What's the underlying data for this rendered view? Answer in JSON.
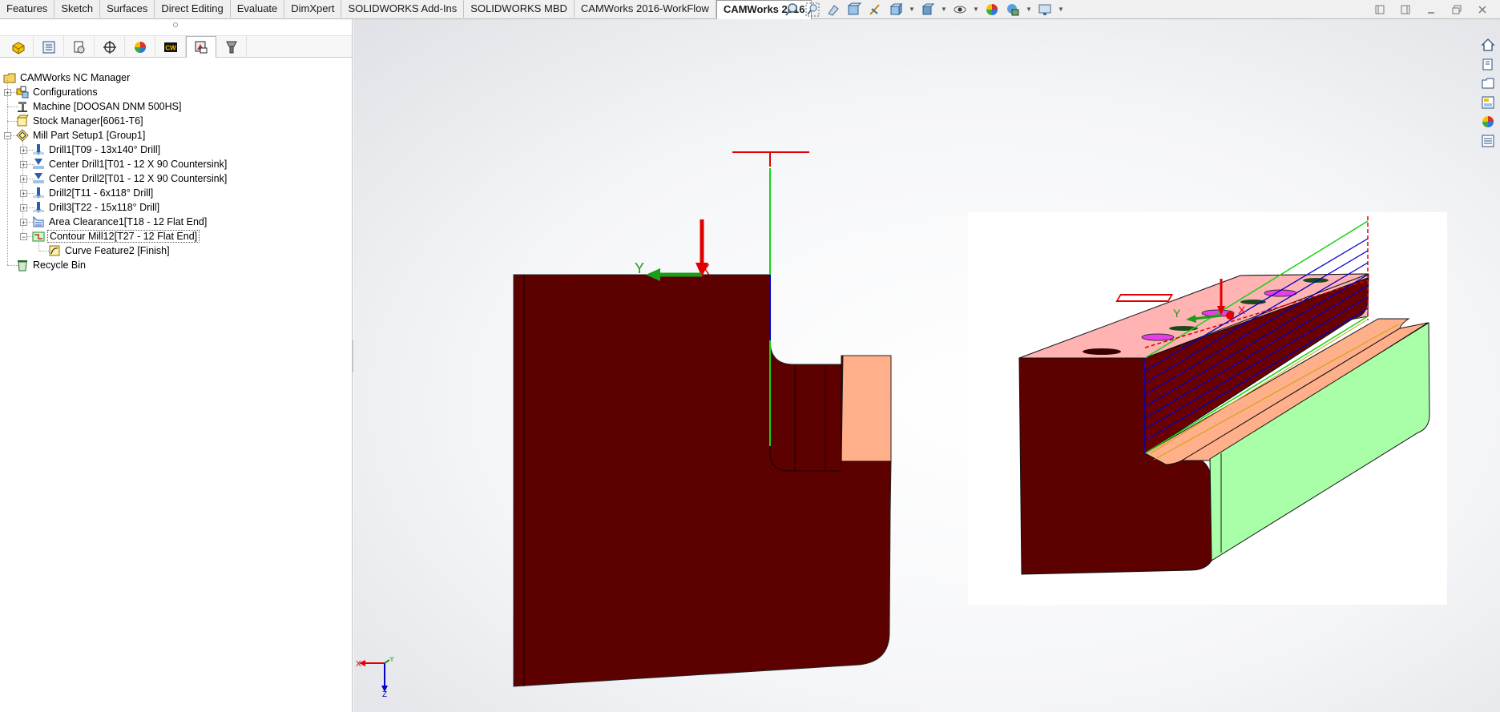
{
  "tabs": [
    {
      "label": "Features"
    },
    {
      "label": "Sketch"
    },
    {
      "label": "Surfaces"
    },
    {
      "label": "Direct Editing"
    },
    {
      "label": "Evaluate"
    },
    {
      "label": "DimXpert"
    },
    {
      "label": "SOLIDWORKS Add-Ins"
    },
    {
      "label": "SOLIDWORKS MBD"
    },
    {
      "label": "CAMWorks 2016-WorkFlow"
    },
    {
      "label": "CAMWorks 2016",
      "active": true
    }
  ],
  "view_toolbar": {
    "icons": [
      "zoom-to-fit-icon",
      "zoom-to-area-icon",
      "previous-view-icon",
      "section-view-icon",
      "dynamic-annotation-icon",
      "view-orientation-icon",
      "display-style-icon",
      "hide-show-items-icon",
      "edit-appearance-icon",
      "apply-scene-icon",
      "view-settings-icon"
    ]
  },
  "window_controls": [
    "restore-icon",
    "tile-icon",
    "minimize-icon",
    "maximize-icon",
    "close-icon"
  ],
  "manager_tabs": [
    {
      "name": "camworks-feature-tree-icon"
    },
    {
      "name": "property-manager-icon"
    },
    {
      "name": "configuration-manager-icon"
    },
    {
      "name": "dimxpert-manager-icon"
    },
    {
      "name": "display-manager-icon"
    },
    {
      "name": "cw-icon",
      "text": "CW"
    },
    {
      "name": "camworks-nc-manager-icon",
      "active": true
    },
    {
      "name": "tool-holder-icon"
    }
  ],
  "tree": {
    "root": "CAMWorks NC Manager",
    "items": [
      {
        "label": "Configurations",
        "icon": "configurations-icon",
        "level": 1,
        "expander": "+"
      },
      {
        "label": "Machine [DOOSAN DNM 500HS]",
        "icon": "machine-icon",
        "level": 1,
        "expander": ""
      },
      {
        "label": "Stock Manager[6061-T6]",
        "icon": "stock-icon",
        "level": 1,
        "expander": ""
      },
      {
        "label": "Mill Part Setup1 [Group1]",
        "icon": "mill-setup-icon",
        "level": 1,
        "expander": "-"
      },
      {
        "label": "Drill1[T09 - 13x140° Drill]",
        "icon": "drill-icon",
        "level": 2,
        "expander": "+"
      },
      {
        "label": "Center Drill1[T01 - 12 X 90 Countersink]",
        "icon": "center-drill-icon",
        "level": 2,
        "expander": "+"
      },
      {
        "label": "Center Drill2[T01 - 12 X 90 Countersink]",
        "icon": "center-drill-icon",
        "level": 2,
        "expander": "+"
      },
      {
        "label": "Drill2[T11 - 6x118° Drill]",
        "icon": "drill-icon",
        "level": 2,
        "expander": "+"
      },
      {
        "label": "Drill3[T22 - 15x118° Drill]",
        "icon": "drill-icon",
        "level": 2,
        "expander": "+"
      },
      {
        "label": "Area Clearance1[T18 - 12 Flat End]",
        "icon": "area-clearance-icon",
        "level": 2,
        "expander": "+"
      },
      {
        "label": "Contour Mill12[T27 - 12 Flat End]",
        "icon": "contour-mill-icon",
        "level": 2,
        "expander": "-",
        "selected": true
      },
      {
        "label": "Curve Feature2 [Finish]",
        "icon": "curve-feature-icon",
        "level": 3,
        "expander": ""
      },
      {
        "label": "Recycle Bin",
        "icon": "recycle-bin-icon",
        "level": 1,
        "expander": ""
      }
    ]
  },
  "viewport": {
    "axis_labels": {
      "left_y": "Y",
      "left_x": "X",
      "right_y": "Y",
      "right_x": "X"
    },
    "triad": {
      "x": "X",
      "y": "Y",
      "z": "Z"
    },
    "colors": {
      "part_dark": "#5c0000",
      "part_light": "#ffb08a",
      "part_pink": "#ffb3b3",
      "side_green": "#a8ffa8",
      "toolpath_blue": "#0000cc",
      "toolpath_green": "#00cc00",
      "axis_red": "#e00000",
      "axis_green": "#1a9e1a",
      "hole_magenta": "#e83ee8"
    }
  },
  "right_toolbar": [
    "home-icon",
    "3d-views-icon",
    "file-explorer-icon",
    "view-palette-icon",
    "appearances-icon",
    "custom-properties-icon"
  ]
}
